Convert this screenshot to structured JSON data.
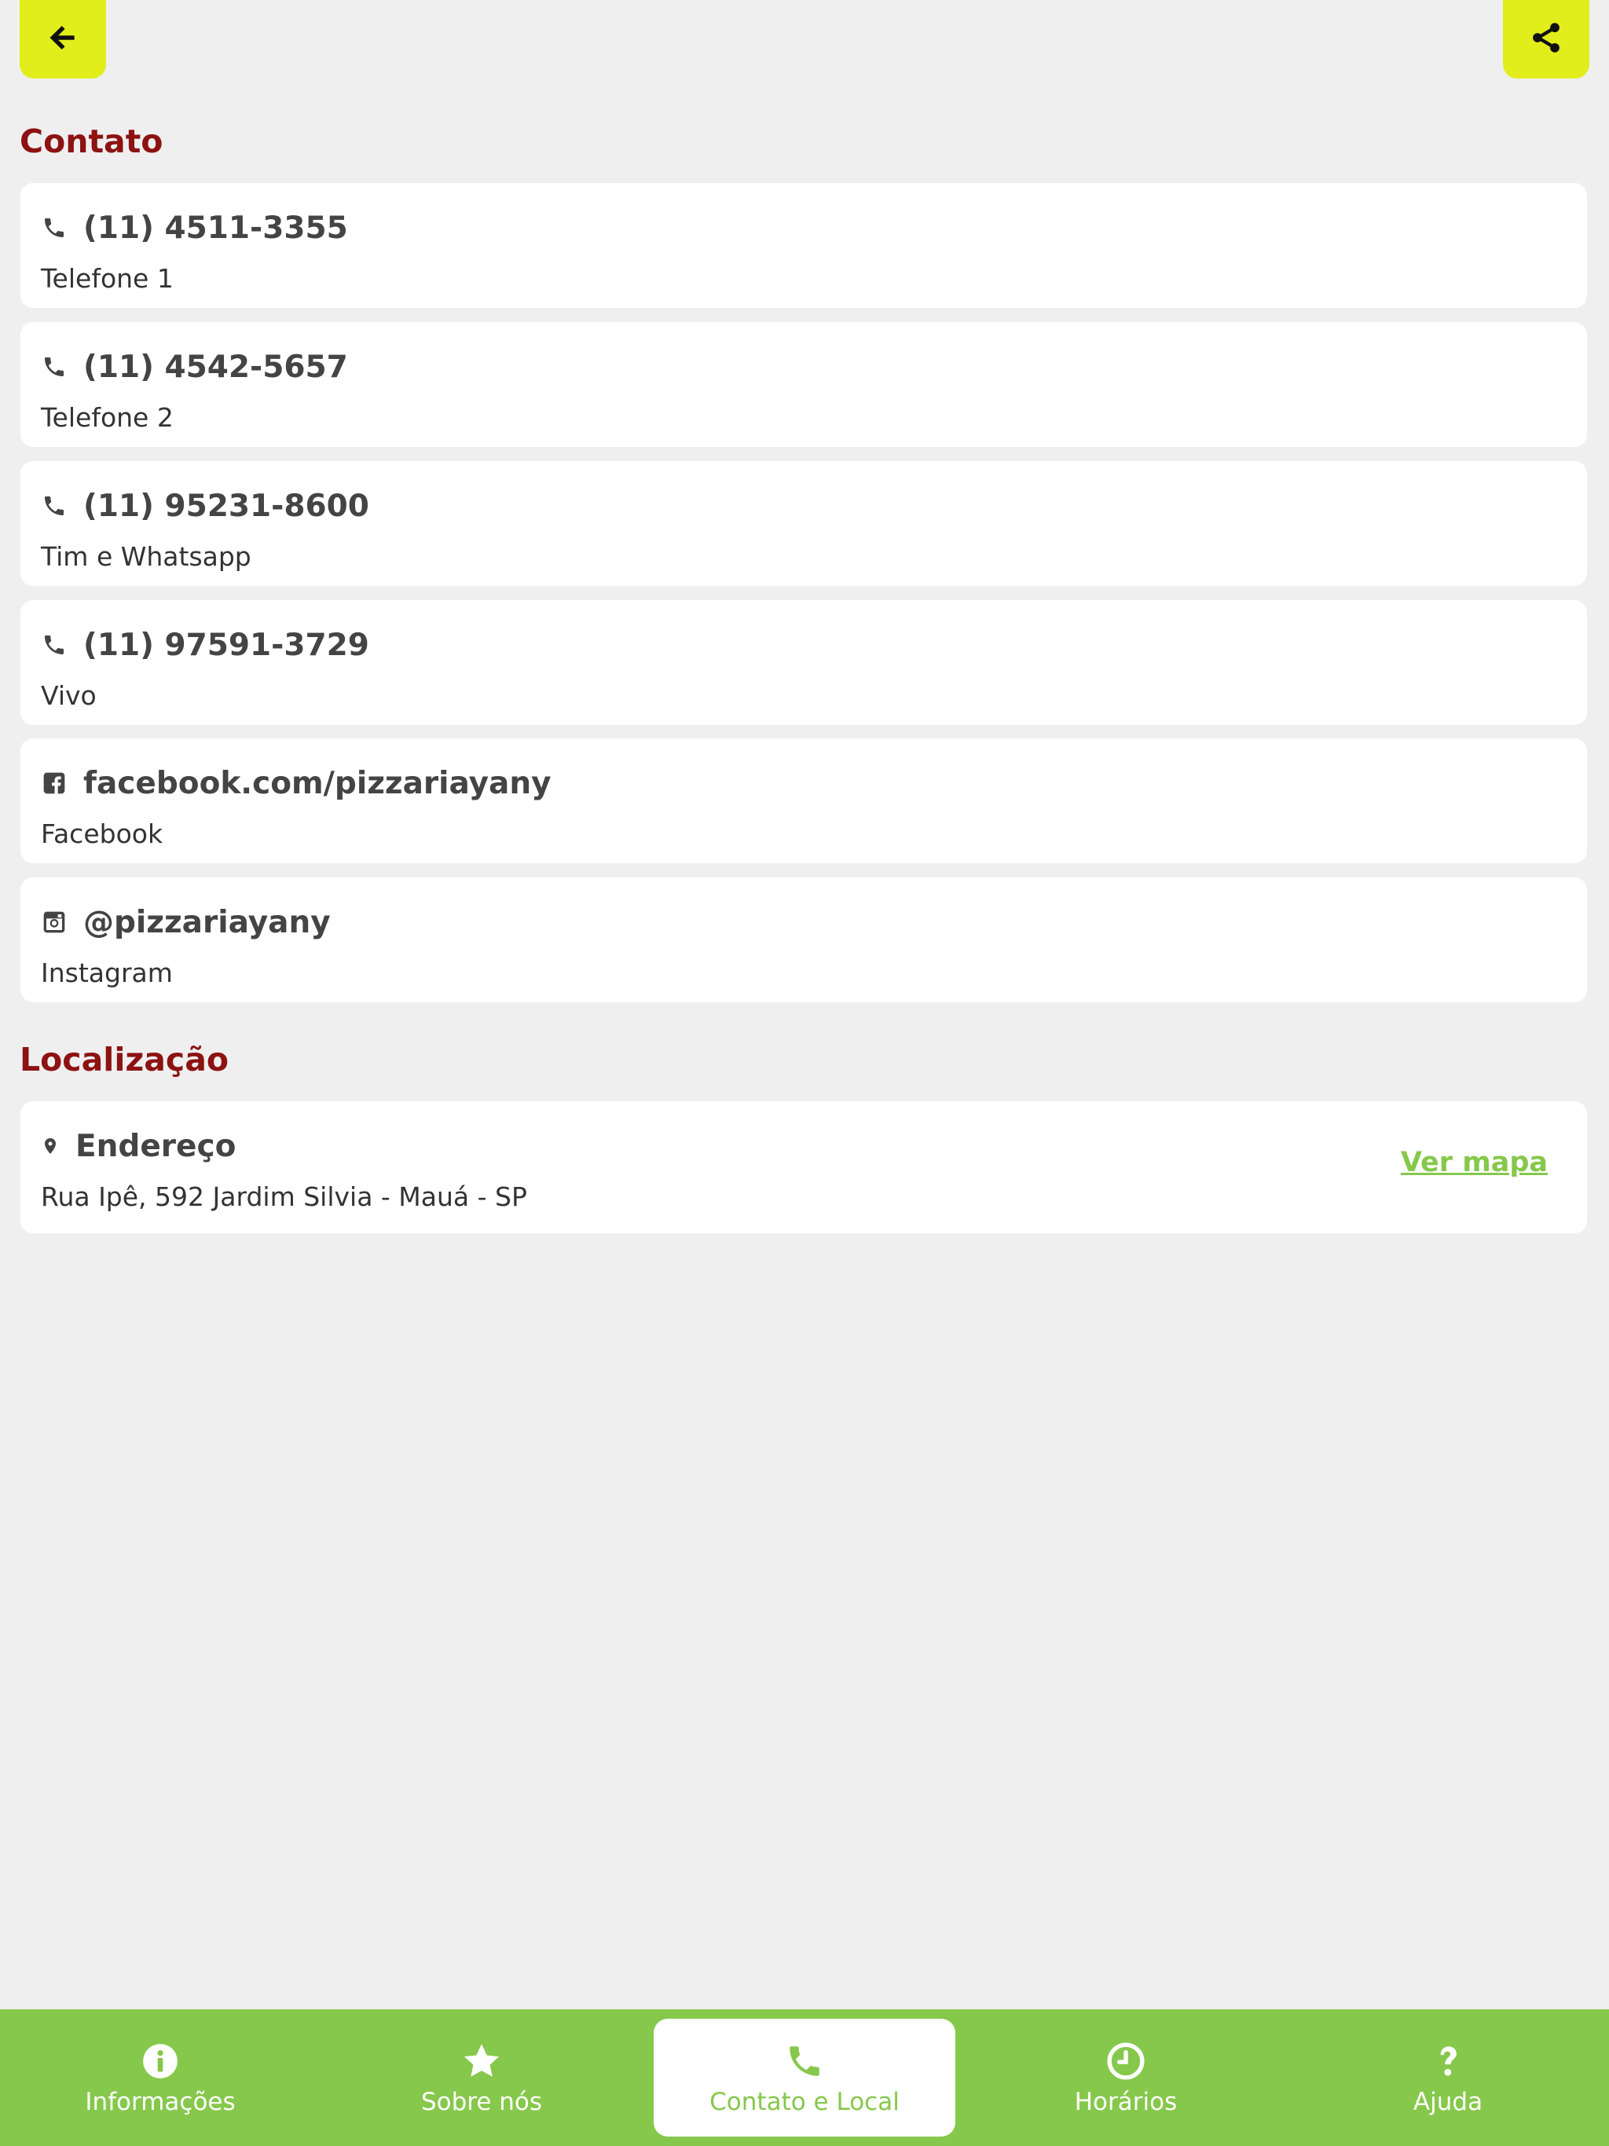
{
  "header": {
    "back_icon": "arrow-left-icon",
    "share_icon": "share-icon",
    "accent_color": "#e2ee1c"
  },
  "contact": {
    "section_title": "Contato",
    "items": [
      {
        "icon": "phone-icon",
        "title": "(11) 4511-3355",
        "subtitle": "Telefone 1"
      },
      {
        "icon": "phone-icon",
        "title": "(11) 4542-5657",
        "subtitle": "Telefone 2"
      },
      {
        "icon": "phone-icon",
        "title": "(11) 95231-8600",
        "subtitle": "Tim e Whatsapp"
      },
      {
        "icon": "phone-icon",
        "title": "(11) 97591-3729",
        "subtitle": "Vivo"
      },
      {
        "icon": "facebook-icon",
        "title": "facebook.com/pizzariayany",
        "subtitle": "Facebook"
      },
      {
        "icon": "instagram-icon",
        "title": "@pizzariayany",
        "subtitle": "Instagram"
      }
    ]
  },
  "location": {
    "section_title": "Localização",
    "icon": "map-marker-icon",
    "title": "Endereço",
    "address": "Rua Ipê, 592 Jardim Silvia - Mauá - SP",
    "map_link": "Ver mapa"
  },
  "nav": {
    "items": [
      {
        "icon": "info-icon",
        "label": "Informações",
        "active": false
      },
      {
        "icon": "star-icon",
        "label": "Sobre nós",
        "active": false
      },
      {
        "icon": "phone-icon",
        "label": "Contato e Local",
        "active": true
      },
      {
        "icon": "clock-icon",
        "label": "Horários",
        "active": false
      },
      {
        "icon": "question-icon",
        "label": "Ajuda",
        "active": false
      }
    ]
  },
  "colors": {
    "section_title": "#8d1212",
    "nav_background": "#86c84b",
    "page_background": "#efefef"
  }
}
